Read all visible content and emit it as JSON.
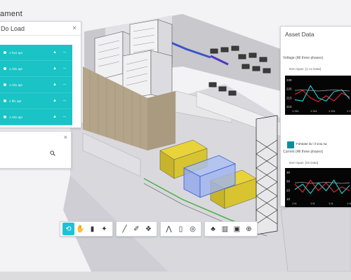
{
  "app": {
    "title": "ament"
  },
  "left_panel": {
    "title": "Do Load",
    "close_glyph": "×",
    "items": [
      {
        "label": "1 fra1 apt",
        "icon1": "▲",
        "icon2": "⇔"
      },
      {
        "label": "1 Alt1 apt",
        "icon1": "▲",
        "icon2": "⇔"
      },
      {
        "label": "1 Alt1 apt",
        "icon1": "▲",
        "icon2": "⇔"
      },
      {
        "label": "1 flt1 apt",
        "icon1": "▲",
        "icon2": "⇔"
      },
      {
        "label": "1 Alt1 apt",
        "icon1": "▲",
        "icon2": "⇔"
      }
    ]
  },
  "search_panel": {
    "close_glyph": "×",
    "value": "",
    "icon": "search-icon"
  },
  "right_panel": {
    "title": "Asset Data",
    "chart1": {
      "label": "Voltage (All three phases)",
      "meta": "Item  Span: [1 Ax Data]",
      "y_ticks": [
        "230",
        "225",
        "215",
        "210"
      ],
      "x_ticks": [
        "1 211",
        "1 211",
        "1 211",
        "1 211"
      ]
    },
    "badge_label": "Fuheate ilo l il sctu na",
    "chart2": {
      "label": "Current (All three phases)",
      "meta": "Item  Span: [0s Data]",
      "y_ticks": [
        "30",
        "30",
        "20",
        "10"
      ],
      "x_ticks": [
        "1 t1",
        "1 t1",
        "1 t1",
        "1 t1"
      ]
    }
  },
  "chart_data": [
    {
      "type": "line",
      "title": "Voltage (All three phases)",
      "y_tick_labels": [
        "230",
        "225",
        "215",
        "210"
      ],
      "series": [
        {
          "color": "#e0202e",
          "values": [
            0.45,
            0.6,
            0.32,
            0.18,
            0.4,
            0.2,
            0.5,
            0.35
          ]
        },
        {
          "color": "#1ec7c7",
          "values": [
            0.25,
            0.2,
            0.78,
            0.32,
            0.2,
            0.55,
            0.62,
            0.28
          ]
        },
        {
          "color": "#9a9a9a",
          "values": [
            0.6,
            0.62,
            0.6,
            0.58,
            0.6,
            0.62,
            0.6,
            0.58
          ]
        }
      ]
    },
    {
      "type": "line",
      "title": "Current (All three phases)",
      "y_tick_labels": [
        "30",
        "30",
        "20",
        "10"
      ],
      "series": [
        {
          "color": "#e0202e",
          "values": [
            0.55,
            0.25,
            0.7,
            0.3,
            0.6,
            0.25,
            0.45,
            0.3
          ]
        },
        {
          "color": "#1ec7c7",
          "values": [
            0.35,
            0.55,
            0.2,
            0.6,
            0.3,
            0.7,
            0.2,
            0.5
          ]
        },
        {
          "color": "#9a9a9a",
          "values": [
            0.6,
            0.62,
            0.58,
            0.6,
            0.62,
            0.6,
            0.58,
            0.6
          ]
        }
      ]
    }
  ],
  "toolbar": {
    "groups": [
      [
        {
          "icon": "orbit-icon",
          "glyph": "⟲",
          "active": true
        },
        {
          "icon": "pan-hand-icon",
          "glyph": "✋"
        },
        {
          "icon": "camera-icon",
          "glyph": "▮"
        },
        {
          "icon": "first-person-icon",
          "glyph": "✦"
        }
      ],
      [
        {
          "icon": "measure-icon",
          "glyph": "╱"
        },
        {
          "icon": "markup-icon",
          "glyph": "✐"
        },
        {
          "icon": "section-icon",
          "glyph": "❖"
        }
      ],
      [
        {
          "icon": "compass-icon",
          "glyph": "⋀"
        },
        {
          "icon": "explode-icon",
          "glyph": "▯"
        },
        {
          "icon": "settings-icon",
          "glyph": "◎"
        }
      ],
      [
        {
          "icon": "model-browser-icon",
          "glyph": "♣"
        },
        {
          "icon": "properties-icon",
          "glyph": "▥"
        },
        {
          "icon": "data-icon",
          "glyph": "▣"
        },
        {
          "icon": "fullscreen-icon",
          "glyph": "⊕"
        }
      ]
    ]
  }
}
